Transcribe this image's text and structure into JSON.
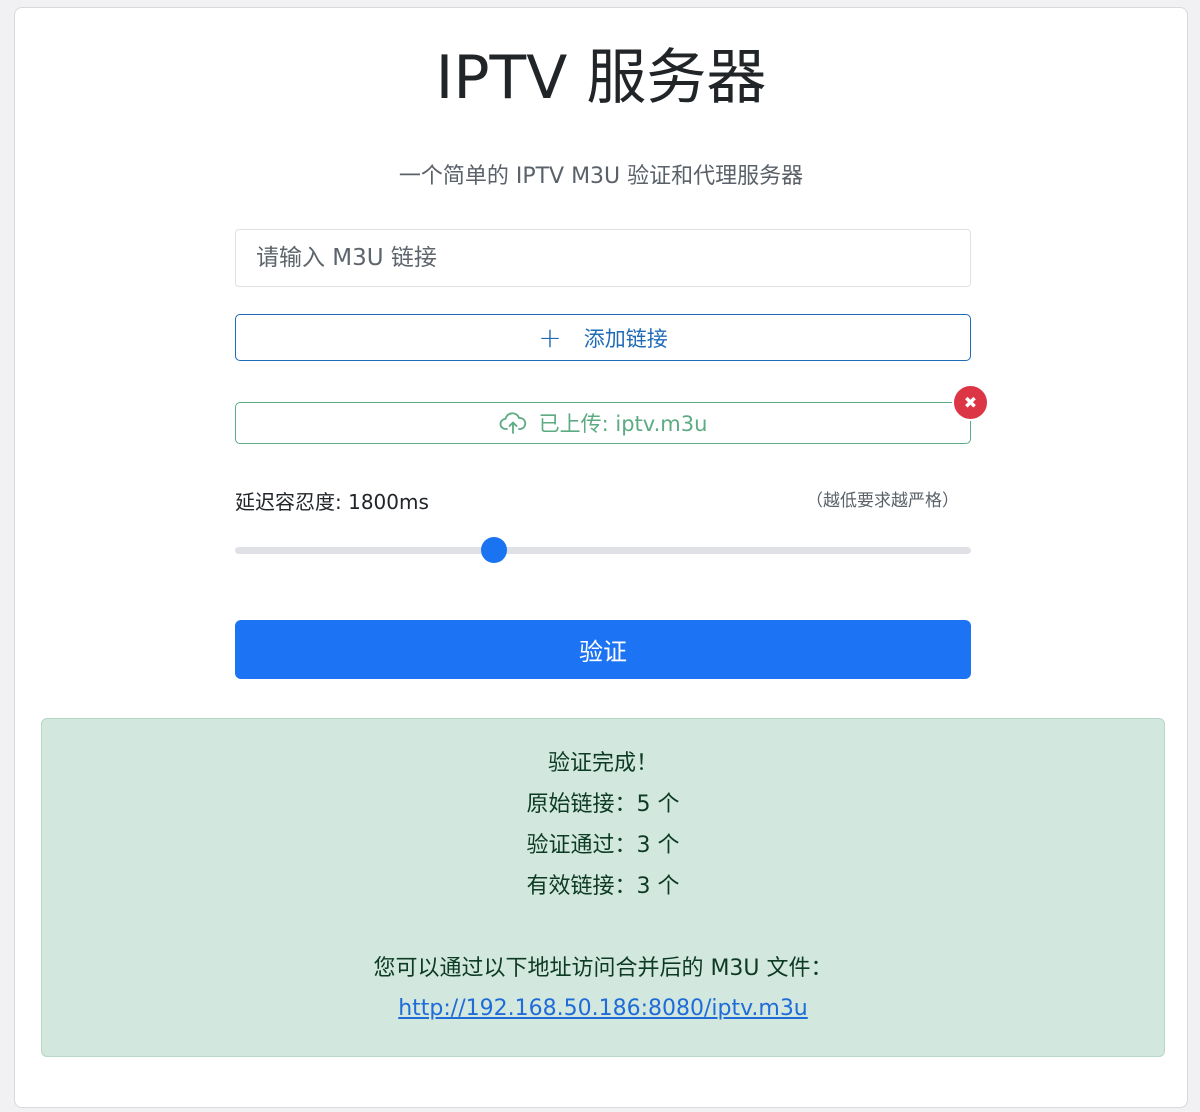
{
  "header": {
    "title": "IPTV 服务器",
    "subtitle": "一个简单的 IPTV M3U 验证和代理服务器"
  },
  "form": {
    "url_input": {
      "placeholder": "请输入 M3U 链接",
      "value": ""
    },
    "add_button": {
      "icon": "plus-icon",
      "label": "添加链接"
    },
    "upload": {
      "icon": "cloud-upload-icon",
      "label": "已上传: iptv.m3u",
      "remove_icon": "close-icon",
      "remove_label": "✖"
    },
    "latency": {
      "label": "延迟容忍度: 1800ms",
      "hint": "（越低要求越严格）",
      "value_ms": 1800,
      "fraction": 0.352
    },
    "verify_button": {
      "label": "验证"
    }
  },
  "result": {
    "title": "验证完成！",
    "original_links": "原始链接：5 个",
    "verified_links": "验证通过：3 个",
    "valid_links": "有效链接：3 个",
    "access_message": "您可以通过以下地址访问合并后的 M3U 文件：",
    "link": "http://192.168.50.186:8080/iptv.m3u"
  },
  "colors": {
    "primary": "#1c74f5",
    "success": "#5cab82",
    "danger": "#dc3545",
    "result_bg": "#d2e7de"
  }
}
